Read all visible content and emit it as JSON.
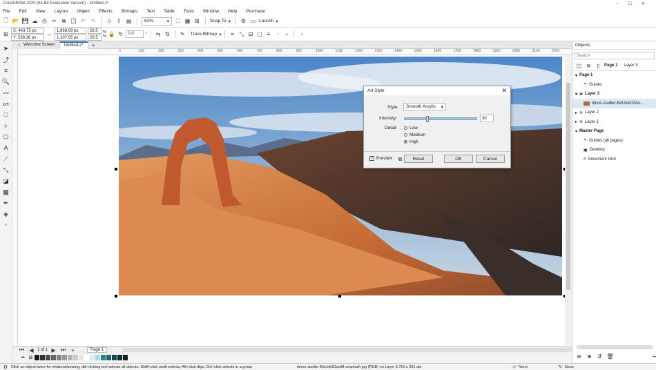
{
  "window": {
    "title": "CorelDRAW 2020 (64-Bit Evaluation Version) - Untitled-2*"
  },
  "menu": [
    "File",
    "Edit",
    "View",
    "Layout",
    "Object",
    "Effects",
    "Bitmaps",
    "Text",
    "Table",
    "Tools",
    "Window",
    "Help",
    "Purchase"
  ],
  "toolbar": {
    "zoom": "62%",
    "snap_label": "Snap To",
    "launch_label": "Launch"
  },
  "propbar": {
    "x": "X: 443.75 px",
    "y": "Y: 538.36 px",
    "w": "1,968.08 px",
    "h": "1,107.05 px",
    "scale_w": "28.5",
    "scale_h": "28.5",
    "pct": "%",
    "angle": "0.0",
    "degree": "°",
    "trace_label": "Trace Bitmap"
  },
  "tabs": [
    {
      "label": "Welcome Screen"
    },
    {
      "label": "Untitled-2*"
    }
  ],
  "ruler": [
    "0",
    "100",
    "200",
    "300",
    "400",
    "500",
    "600",
    "700",
    "800",
    "900",
    "1000",
    "1100",
    "1200",
    "1300",
    "1400",
    "1500",
    "1600",
    "1700",
    "1800",
    "1900",
    "2000",
    "2100",
    "2200"
  ],
  "dialog": {
    "title": "Art Style",
    "style_label": "Style:",
    "style_value": "Smooth Acrylic",
    "intensity_label": "Intensity:",
    "intensity_value": "30",
    "intensity_fraction": 0.3,
    "detail_label": "Detail:",
    "detail_options": [
      "Low",
      "Medium",
      "High"
    ],
    "detail_selected": "High",
    "preview_label": "Preview",
    "reset_label": "Reset",
    "ok_label": "OK",
    "cancel_label": "Cancel"
  },
  "pagenav": {
    "count": "1 of 1",
    "page": "Page 1"
  },
  "palette": [
    "#1a1a1a",
    "#333333",
    "#4d4d4d",
    "#666666",
    "#808080",
    "#999999",
    "#b3b3b3",
    "#cccccc",
    "#e6e6e6",
    "#ffffff",
    "#d8eef6",
    "#a7d8e8",
    "#1f8a8a",
    "#17676a",
    "#0f4b4e",
    "#0a2e30",
    "#1a1a1a"
  ],
  "status": {
    "hint": "Click an object twice for rotation/skewing; dbl-clicking tool selects all objects; Shift+click multi-selects; Alt+click digs; Ctrl+click selects in a group",
    "object": "timon-studler-BxUokl03zwM-unsplash.jpg (RGB) on Layer 3 751 x 251 dpi",
    "fill": "None",
    "outline": "None"
  },
  "objects": {
    "header": "Objects",
    "search_placeholder": "Search",
    "current_page": "Page 1",
    "current_layer": "Layer 3",
    "page": "Page 1",
    "guides": "Guides",
    "layer3": "Layer 3",
    "bitmap": "timon-studler-BxUokl03zw...",
    "layer2": "Layer 2",
    "layer1": "Layer 1",
    "master": "Master Page",
    "guides_all": "Guides (all pages)",
    "desktop": "Desktop",
    "grid": "Document Grid"
  }
}
